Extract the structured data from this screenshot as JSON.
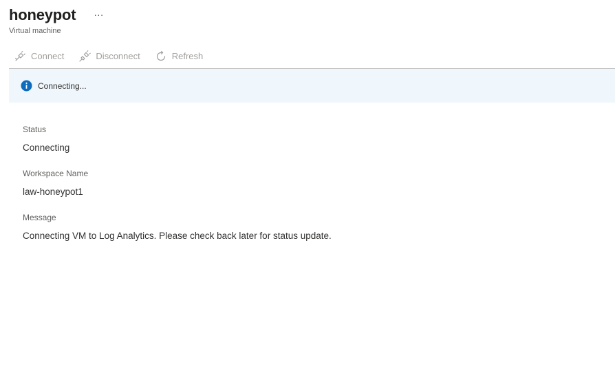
{
  "header": {
    "title": "honeypot",
    "more_label": "···",
    "subtitle": "Virtual machine"
  },
  "toolbar": {
    "connect_label": "Connect",
    "disconnect_label": "Disconnect",
    "refresh_label": "Refresh",
    "disabled_color": "#a19f9d"
  },
  "banner": {
    "text": "Connecting...",
    "icon": "info-icon",
    "icon_color": "#0f6cbd",
    "background": "#eff6fc"
  },
  "details": {
    "status_label": "Status",
    "status_value": "Connecting",
    "workspace_label": "Workspace Name",
    "workspace_value": "law-honeypot1",
    "message_label": "Message",
    "message_value": "Connecting VM to Log Analytics. Please check back later for status update."
  }
}
